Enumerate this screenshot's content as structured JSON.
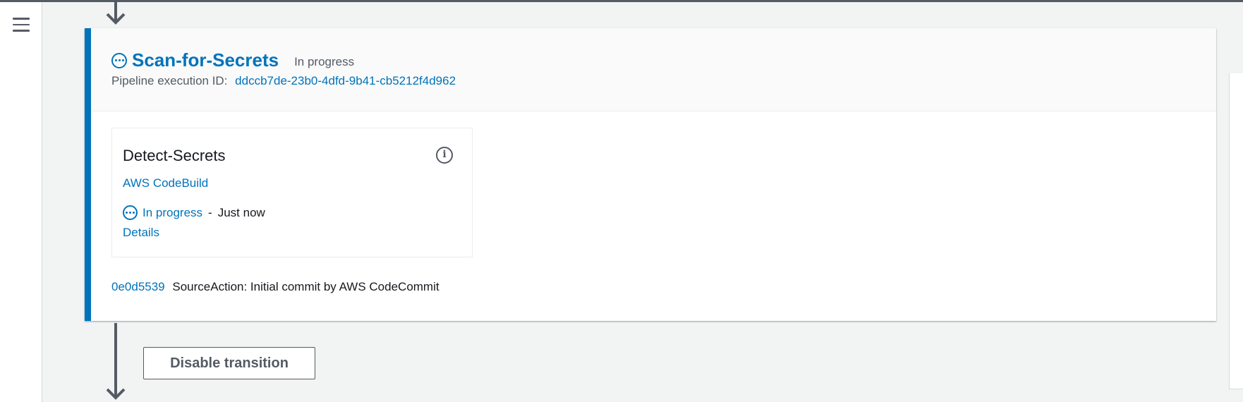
{
  "nav": {
    "menu_icon": "hamburger-menu-icon"
  },
  "stage": {
    "name": "Scan-for-Secrets",
    "status": "In progress",
    "execution_label": "Pipeline execution ID:",
    "execution_id": "ddccb7de-23b0-4dfd-9b41-cb5212f4d962",
    "status_icon": "in-progress-icon"
  },
  "action": {
    "name": "Detect-Secrets",
    "provider": "AWS CodeBuild",
    "status": "In progress",
    "separator": "-",
    "time": "Just now",
    "details_label": "Details",
    "info_icon": "info-icon"
  },
  "commit": {
    "id": "0e0d5539",
    "message": "SourceAction: Initial commit by AWS CodeCommit"
  },
  "transition": {
    "button_label": "Disable transition"
  },
  "colors": {
    "accent": "#0073bb",
    "text": "#16191f",
    "muted": "#545b64",
    "background": "#f2f3f3"
  }
}
